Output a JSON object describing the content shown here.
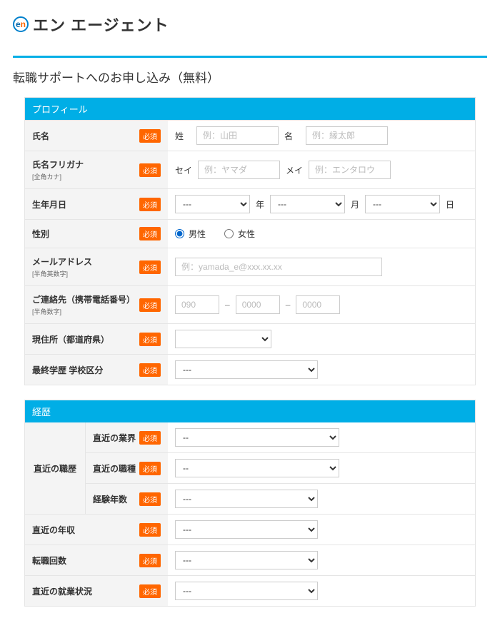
{
  "logo": {
    "icon": "en",
    "text": "エン エージェント"
  },
  "page_title": "転職サポートへのお申し込み（無料）",
  "badge_text": "必須",
  "sections": {
    "profile": {
      "header": "プロフィール",
      "name": {
        "label": "氏名",
        "sei": "姓",
        "mei": "名",
        "ph_sei": "例：山田",
        "ph_mei": "例：縁太郎"
      },
      "furigana": {
        "label": "氏名フリガナ",
        "sub": "[全角カナ]",
        "sei": "セイ",
        "mei": "メイ",
        "ph_sei": "例：ヤマダ",
        "ph_mei": "例：エンタロウ"
      },
      "birth": {
        "label": "生年月日",
        "year": "年",
        "month": "月",
        "day": "日",
        "placeholder": "---"
      },
      "gender": {
        "label": "性別",
        "male": "男性",
        "female": "女性"
      },
      "email": {
        "label": "メールアドレス",
        "sub": "[半角英数字]",
        "ph": "例：yamada_e@xxx.xx.xx"
      },
      "phone": {
        "label": "ご連絡先（携帯電話番号）",
        "sub": "[半角数字]",
        "ph1": "090",
        "ph2": "0000",
        "ph3": "0000",
        "dash": "–"
      },
      "address": {
        "label": "現住所（都道府県）"
      },
      "education": {
        "label": "最終学歴 学校区分",
        "placeholder": "---"
      }
    },
    "career": {
      "header": "経歴",
      "recent_job": {
        "outer": "直近の職歴",
        "industry": "直近の業界",
        "occupation": "直近の職種",
        "years": "経験年数"
      },
      "income": "直近の年収",
      "changes": "転職回数",
      "status": "直近の就業状況",
      "placeholder_long": "--",
      "placeholder_short": "---"
    }
  }
}
